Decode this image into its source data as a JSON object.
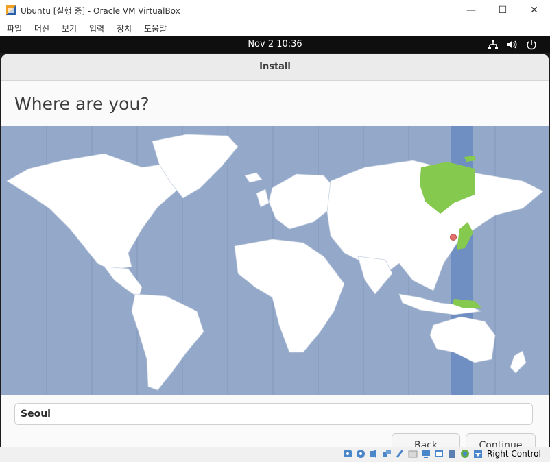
{
  "window": {
    "title": "Ubuntu [실행 중] - Oracle VM VirtualBox",
    "minimize": "—",
    "maximize": "☐",
    "close": "✕"
  },
  "menu": [
    "파일",
    "머신",
    "보기",
    "입력",
    "장치",
    "도움말"
  ],
  "guest_topbar": {
    "clock": "Nov 2  10:36"
  },
  "installer": {
    "title": "Install",
    "heading": "Where are you?",
    "city_value": "Seoul",
    "back_label": "Back",
    "continue_label": "Continue"
  },
  "map": {
    "ocean_color": "#94a9c9",
    "land_color": "#ffffff",
    "highlight_zone_color": "#6f8fc2",
    "highlight_land_color": "#86c94f",
    "marker_color": "#e2706b",
    "selected_timezone": "Asia/Seoul"
  },
  "statusbar": {
    "host_key": "Right Control"
  }
}
